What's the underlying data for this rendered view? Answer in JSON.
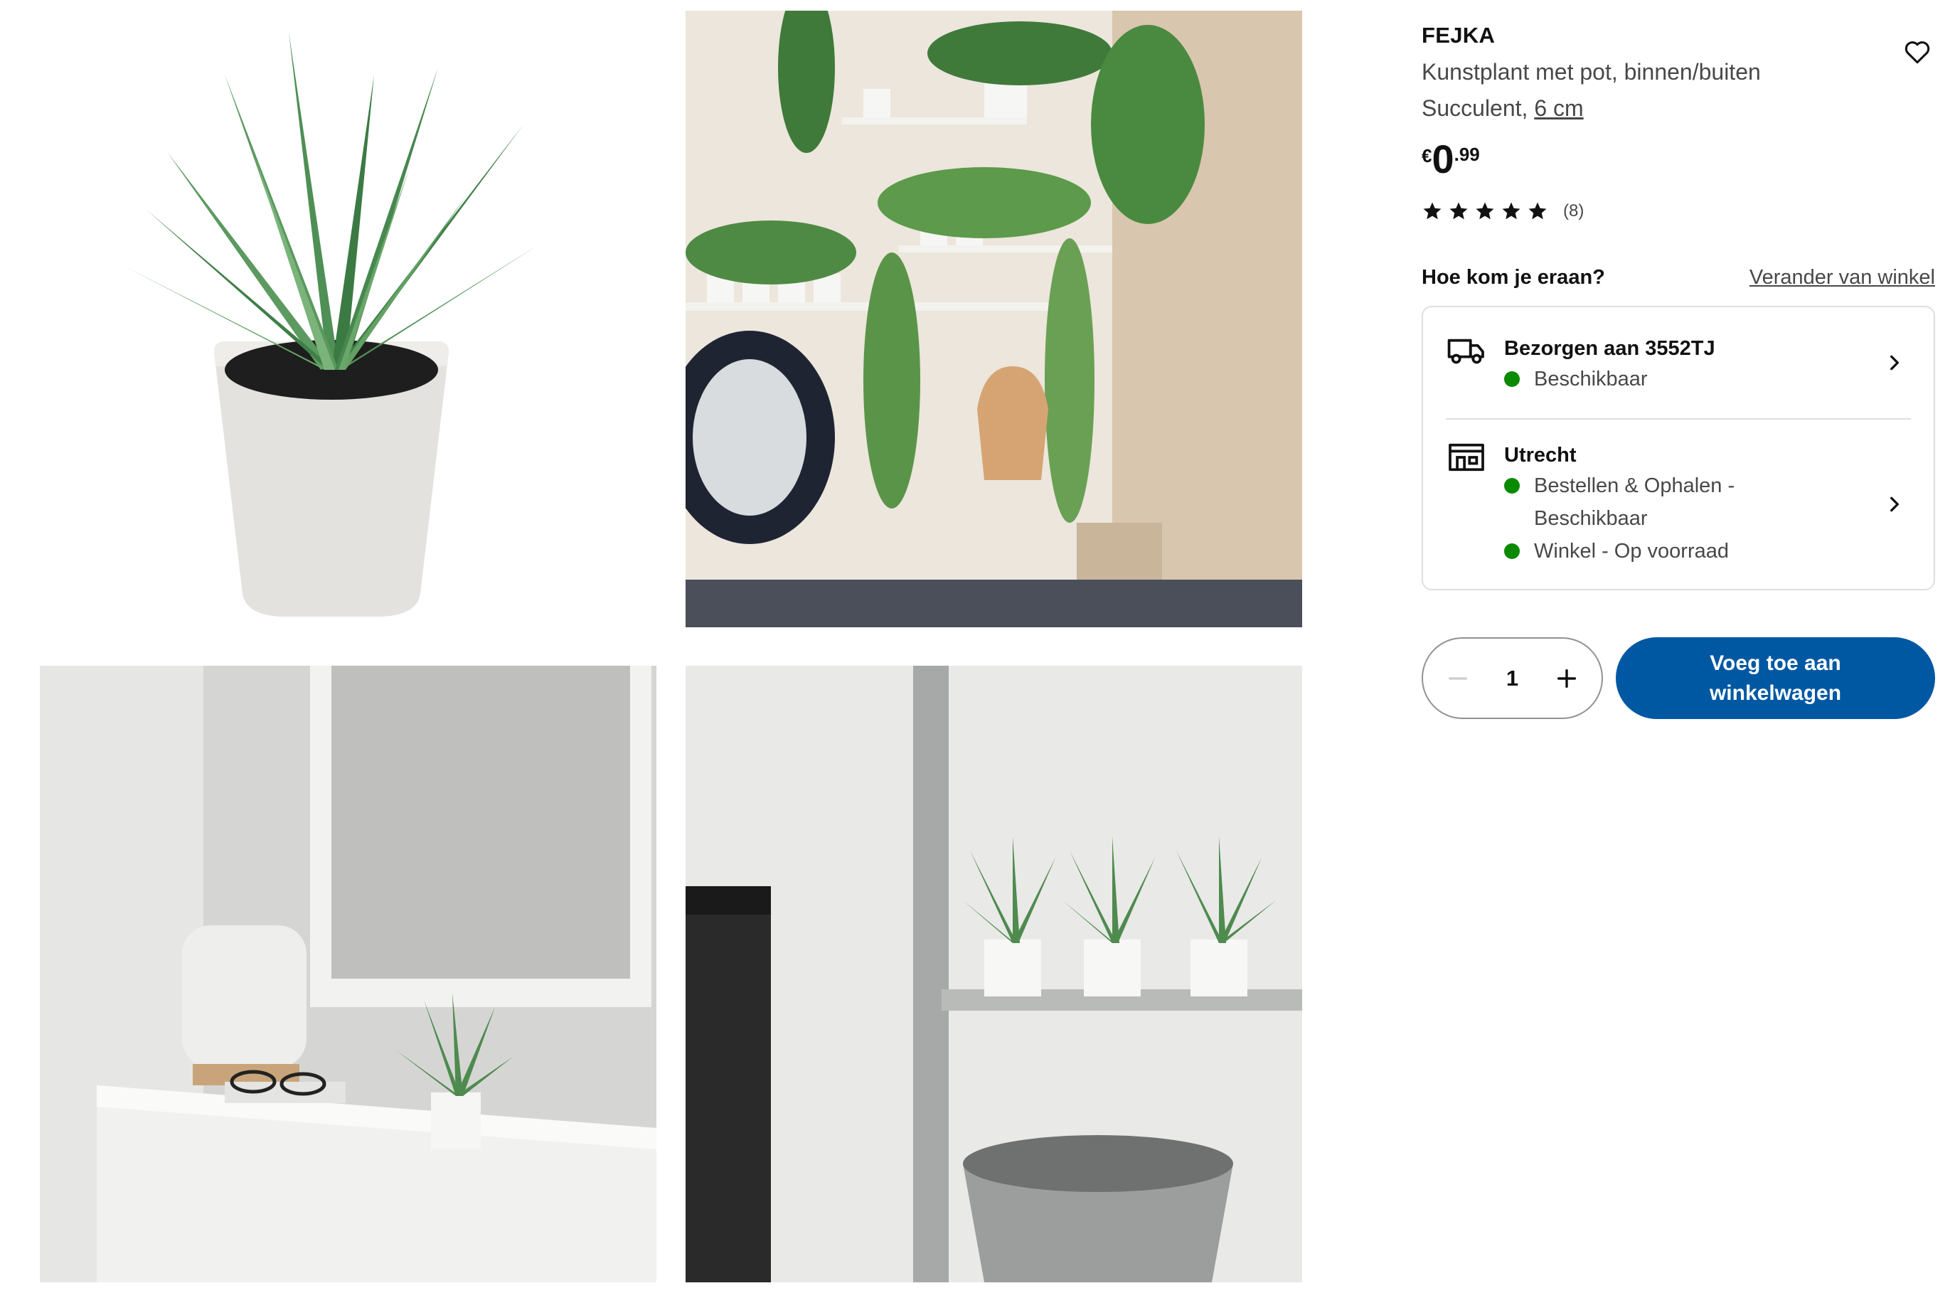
{
  "product": {
    "name": "FEJKA",
    "description": "Kunstplant met pot, binnen/buiten",
    "variant_prefix": "Succulent, ",
    "variant_size": "6 cm",
    "price": {
      "currency": "€",
      "integer": "0",
      "decimals": ".99"
    },
    "rating": {
      "stars": 5,
      "count": "(8)"
    }
  },
  "availability": {
    "question": "Hoe kom je eraan?",
    "change_store": "Verander van winkel",
    "delivery": {
      "title": "Bezorgen aan 3552TJ",
      "status": "Beschikbaar"
    },
    "store": {
      "title": "Utrecht",
      "status_1": "Bestellen & Ophalen -\nBeschikbaar",
      "status_1_a": "Bestellen & Ophalen -",
      "status_1_b": "Beschikbaar",
      "status_2": "Winkel - Op voorraad"
    }
  },
  "cart": {
    "quantity": "1",
    "add_label_line1": "Voeg toe aan",
    "add_label_line2": "winkelwagen"
  },
  "colors": {
    "primary_blue": "#0058a3",
    "available_green": "#0a8a00",
    "text": "#111111",
    "muted": "#484848"
  }
}
